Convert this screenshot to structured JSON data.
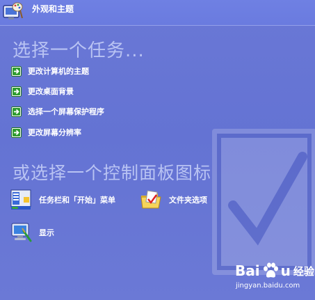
{
  "header": {
    "title": "外观和主题",
    "icon": "appearance-themes-icon"
  },
  "tasks": {
    "heading": "选择一个任务...",
    "items": [
      {
        "label": "更改计算机的主题",
        "icon": "green-arrow-icon"
      },
      {
        "label": "更改桌面背景",
        "icon": "green-arrow-icon"
      },
      {
        "label": "选择一个屏幕保护程序",
        "icon": "green-arrow-icon"
      },
      {
        "label": "更改屏幕分辨率",
        "icon": "green-arrow-icon"
      }
    ]
  },
  "control_panel": {
    "heading": "或选择一个控制面板图标",
    "items": [
      {
        "label": "任务栏和「开始」菜单",
        "icon": "taskbar-start-menu-icon"
      },
      {
        "label": "文件夹选项",
        "icon": "folder-options-icon"
      },
      {
        "label": "显示",
        "icon": "display-icon"
      }
    ]
  },
  "watermark": {
    "brand_text_a": "Bai",
    "brand_text_b": "u",
    "brand_cn": "经验",
    "url": "jingyan.baidu.com"
  },
  "colors": {
    "background": "#6473d3",
    "heading": "#b9c3f3",
    "text": "#ffffff",
    "arrow_green": "#2e9b2e"
  }
}
